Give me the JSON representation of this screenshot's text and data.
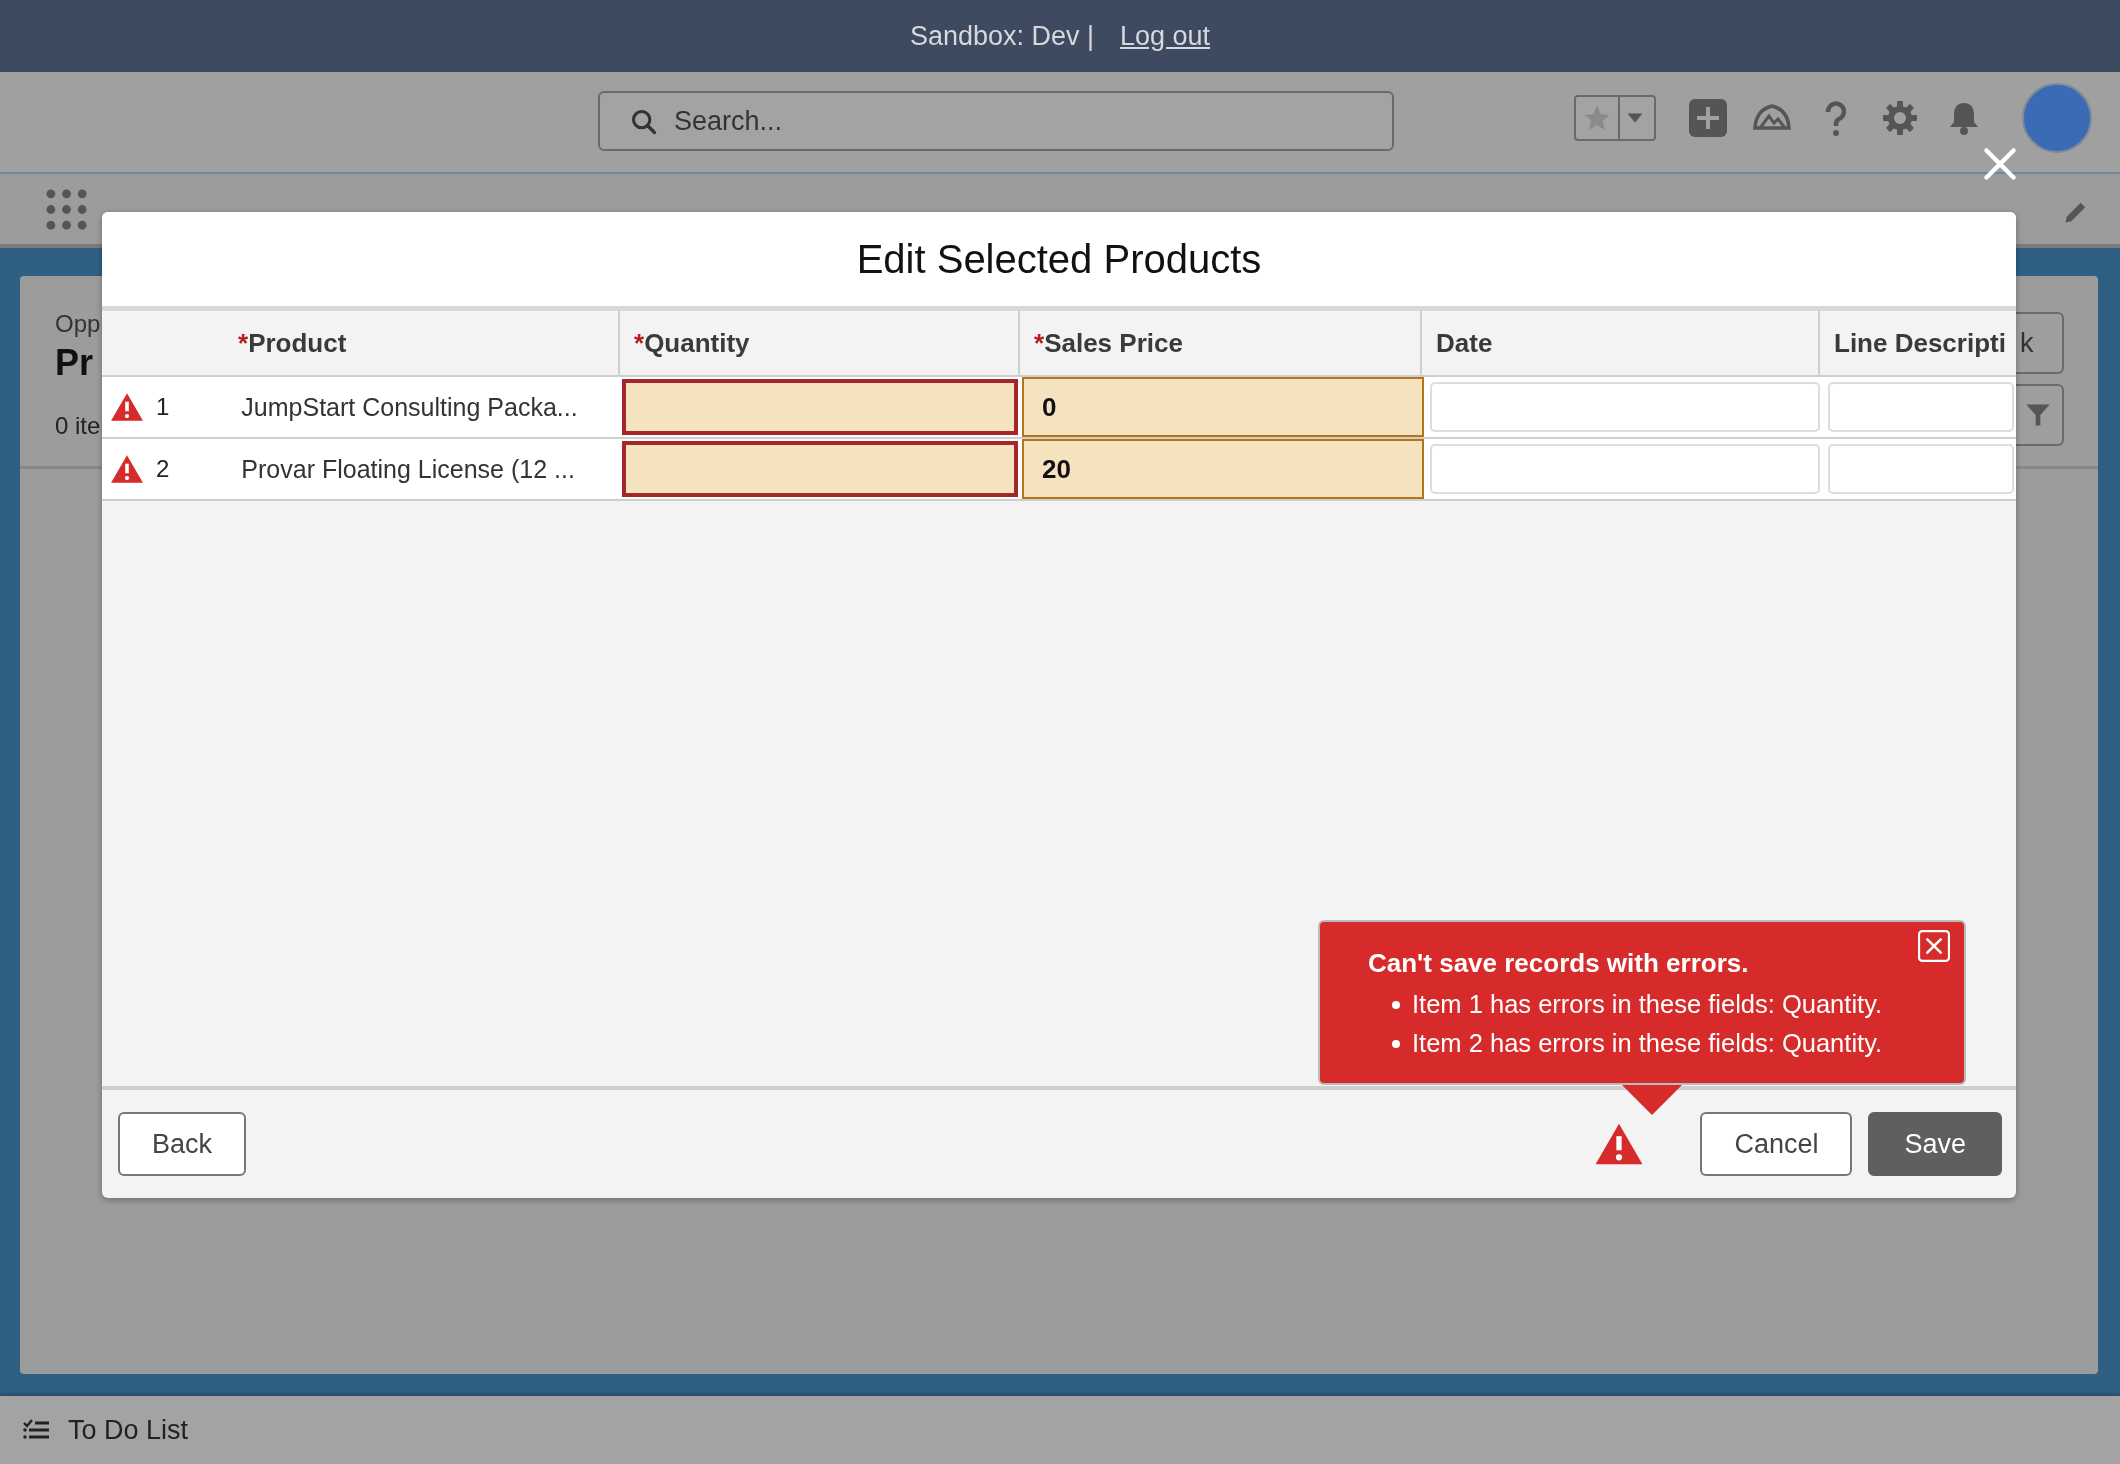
{
  "banner": {
    "text": "Sandbox: Dev |",
    "link": "Log out"
  },
  "search": {
    "placeholder": "Search..."
  },
  "page": {
    "breadcrumb": "Opp",
    "title": "Pr",
    "count": "0 ite",
    "button_tail": "k"
  },
  "modal": {
    "title": "Edit Selected Products",
    "columns": [
      {
        "label": "Product",
        "required_mark": "*"
      },
      {
        "label": "Quantity",
        "required_mark": "*"
      },
      {
        "label": "Sales Price",
        "required_mark": "*"
      },
      {
        "label": "Date"
      },
      {
        "label": "Line Descripti"
      }
    ],
    "rows": [
      {
        "number": "1",
        "error": true,
        "product": "JumpStart Consulting Packa...",
        "quantity_error": true,
        "sales_price": "0",
        "price_edited": true
      },
      {
        "number": "2",
        "error": true,
        "product": "Provar Floating License (12 ...",
        "quantity_error": true,
        "sales_price": "20",
        "price_edited": true
      }
    ],
    "error_popover": {
      "title": "Can't save records with errors.",
      "items": [
        "Item 1 has errors in these fields: Quantity.",
        "Item 2 has errors in these fields: Quantity."
      ]
    },
    "buttons": {
      "back": "Back",
      "cancel": "Cancel",
      "save": "Save"
    }
  },
  "footer": {
    "label": "To Do List"
  }
}
